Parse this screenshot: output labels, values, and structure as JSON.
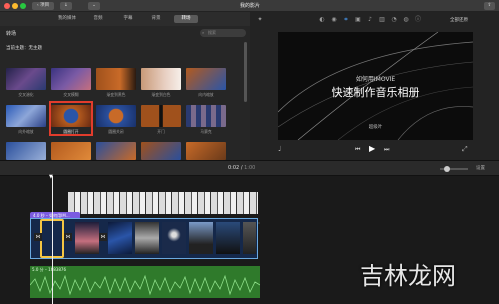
{
  "window": {
    "title": "我的影片",
    "back_label": "项目"
  },
  "tabs": [
    "我的媒体",
    "音频",
    "字幕",
    "背景",
    "转场"
  ],
  "browser": {
    "header": "转场",
    "search_placeholder": "搜索",
    "current_theme": "当前主题：无主题",
    "row1": [
      "交叉溶化",
      "交叉模糊",
      "渐变到黑色",
      "渐变到白色",
      "向内缩放"
    ],
    "row2": [
      "向外缩放",
      "圆圈打开",
      "圆圈关闭",
      "开门",
      "马赛克"
    ]
  },
  "viewer": {
    "reset_label": "全部还原",
    "slide_small": "如何用IMOVIE",
    "slide_big": "快速制作音乐相册",
    "slide_caption": "超级叶"
  },
  "timebar": {
    "current": "0:02",
    "total": "1:00",
    "settings_label": "设置"
  },
  "timeline": {
    "title_clip": "4.0 秒 – 如何用IM...",
    "audio_clip": "5.0 分 – 1683876"
  },
  "watermark": "吉林龙网",
  "colors": {
    "selection": "#e23c2c",
    "audio_green": "#3f9a3a",
    "title_purple": "#7b5be0",
    "clip_blue": "#6aa9e0"
  }
}
